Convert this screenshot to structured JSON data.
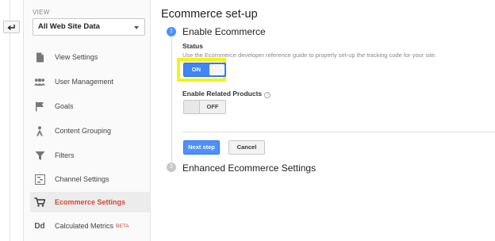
{
  "sidebar": {
    "view_label": "VIEW",
    "view_select_value": "All Web Site Data",
    "items": [
      {
        "label": "View Settings",
        "icon": "document-icon"
      },
      {
        "label": "User Management",
        "icon": "users-icon"
      },
      {
        "label": "Goals",
        "icon": "flag-icon"
      },
      {
        "label": "Content Grouping",
        "icon": "person-icon"
      },
      {
        "label": "Filters",
        "icon": "filter-icon"
      },
      {
        "label": "Channel Settings",
        "icon": "channel-icon"
      },
      {
        "label": "Ecommerce Settings",
        "icon": "cart-icon",
        "active": true
      },
      {
        "label": "Calculated Metrics",
        "icon": "dd-icon",
        "badge": "BETA"
      }
    ]
  },
  "main": {
    "title": "Ecommerce set-up",
    "step1": {
      "number": "1",
      "title": "Enable Ecommerce",
      "status_label": "Status",
      "status_description": "Use the Ecommerce developer reference guide to properly set-up the tracking code for your site.",
      "status_toggle": "ON",
      "related_label": "Enable Related Products",
      "help_symbol": "?",
      "related_toggle": "OFF",
      "next_button": "Next step",
      "cancel_button": "Cancel"
    },
    "step2": {
      "number": "2",
      "title": "Enhanced Ecommerce Settings"
    }
  },
  "colors": {
    "accent_blue": "#4285f4",
    "active_nav": "#d34836",
    "highlight": "#f5f216"
  }
}
